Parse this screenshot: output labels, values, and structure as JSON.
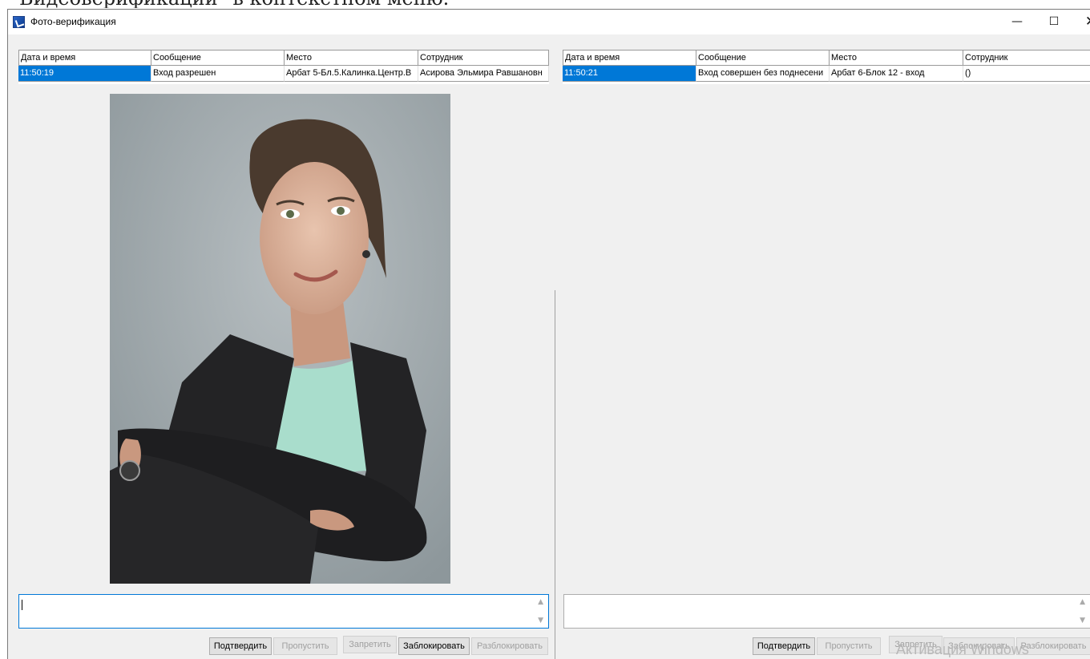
{
  "document": {
    "caption_fragment": "Видеоверификации\" в контекстном меню."
  },
  "window": {
    "title": "Фото-верификация",
    "minimize_glyph": "—",
    "maximize_glyph": "☐",
    "close_glyph": "✕"
  },
  "left_panel": {
    "columns": [
      "Дата и время",
      "Сообщение",
      "Место",
      "Сотрудник"
    ],
    "rows": [
      {
        "time": "11:50:19",
        "message": "Вход разрешен",
        "place": "Арбат 5-Бл.5.Калинка.Центр.В",
        "employee": "Асирова Эльмира Равшановн"
      }
    ],
    "memo_text": "",
    "buttons": {
      "confirm": "Подтвердить",
      "skip": "Пропустить",
      "deny": "Запретить",
      "block": "Заблокировать",
      "unblock": "Разблокировать"
    }
  },
  "right_panel": {
    "columns": [
      "Дата и время",
      "Сообщение",
      "Место",
      "Сотрудник"
    ],
    "rows": [
      {
        "time": "11:50:21",
        "message": "Вход совершен без поднесени",
        "place": "Арбат 6-Блок 12 - вход",
        "employee": "()"
      }
    ],
    "memo_text": "",
    "buttons": {
      "confirm": "Подтвердить",
      "skip": "Пропустить",
      "deny": "Запретить",
      "block": "Заблокировать",
      "unblock": "Разблокировать"
    }
  },
  "watermark": "Активация Windows",
  "colors": {
    "selection": "#0078d7",
    "window_bg": "#f0f0f0"
  },
  "icons": {
    "app": "app-logo-icon",
    "scroll_up": "chevron-up-icon",
    "scroll_down": "chevron-down-icon"
  }
}
